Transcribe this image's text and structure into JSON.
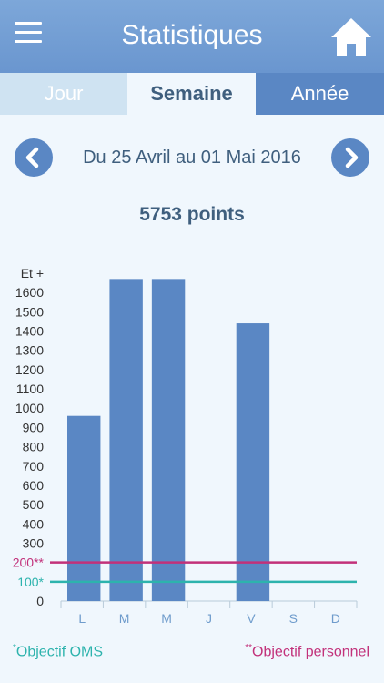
{
  "header": {
    "title": "Statistiques",
    "menu_icon": "hamburger-menu-icon",
    "home_icon": "home-icon"
  },
  "tabs": [
    {
      "label": "Jour",
      "selected": false
    },
    {
      "label": "Semaine",
      "selected": true
    },
    {
      "label": "Année",
      "selected": false
    }
  ],
  "period": {
    "label": "Du 25 Avril au 01 Mai 2016",
    "prev_icon": "chevron-left-icon",
    "next_icon": "chevron-right-icon"
  },
  "summary": {
    "total": "5753 points"
  },
  "chart_data": {
    "type": "bar",
    "categories": [
      "L",
      "M",
      "M",
      "J",
      "V",
      "S",
      "D"
    ],
    "values": [
      960,
      1670,
      1670,
      0,
      1440,
      0,
      0
    ],
    "ylim": [
      0,
      1700
    ],
    "y_tick_labels": [
      "0",
      "100*",
      "200**",
      "300",
      "400",
      "500",
      "600",
      "700",
      "800",
      "900",
      "1000",
      "1100",
      "1200",
      "1300",
      "1400",
      "1500",
      "1600",
      "Et +"
    ],
    "reference_lines": [
      {
        "name": "Objectif OMS",
        "value": 100,
        "color": "#2db3ad"
      },
      {
        "name": "Objectif personnel",
        "value": 200,
        "color": "#c2317a"
      }
    ],
    "bar_color": "#5a87c4",
    "grid": false
  },
  "legend": {
    "oms_mark": "*",
    "oms_label": "Objectif OMS",
    "perso_mark": "**",
    "perso_label": "Objectif personnel"
  },
  "colors": {
    "header": "#6a96cf",
    "accent": "#5a87c4",
    "text": "#3f5f7e",
    "oms": "#2db3ad",
    "perso": "#c2317a",
    "background": "#f0f7fd"
  }
}
